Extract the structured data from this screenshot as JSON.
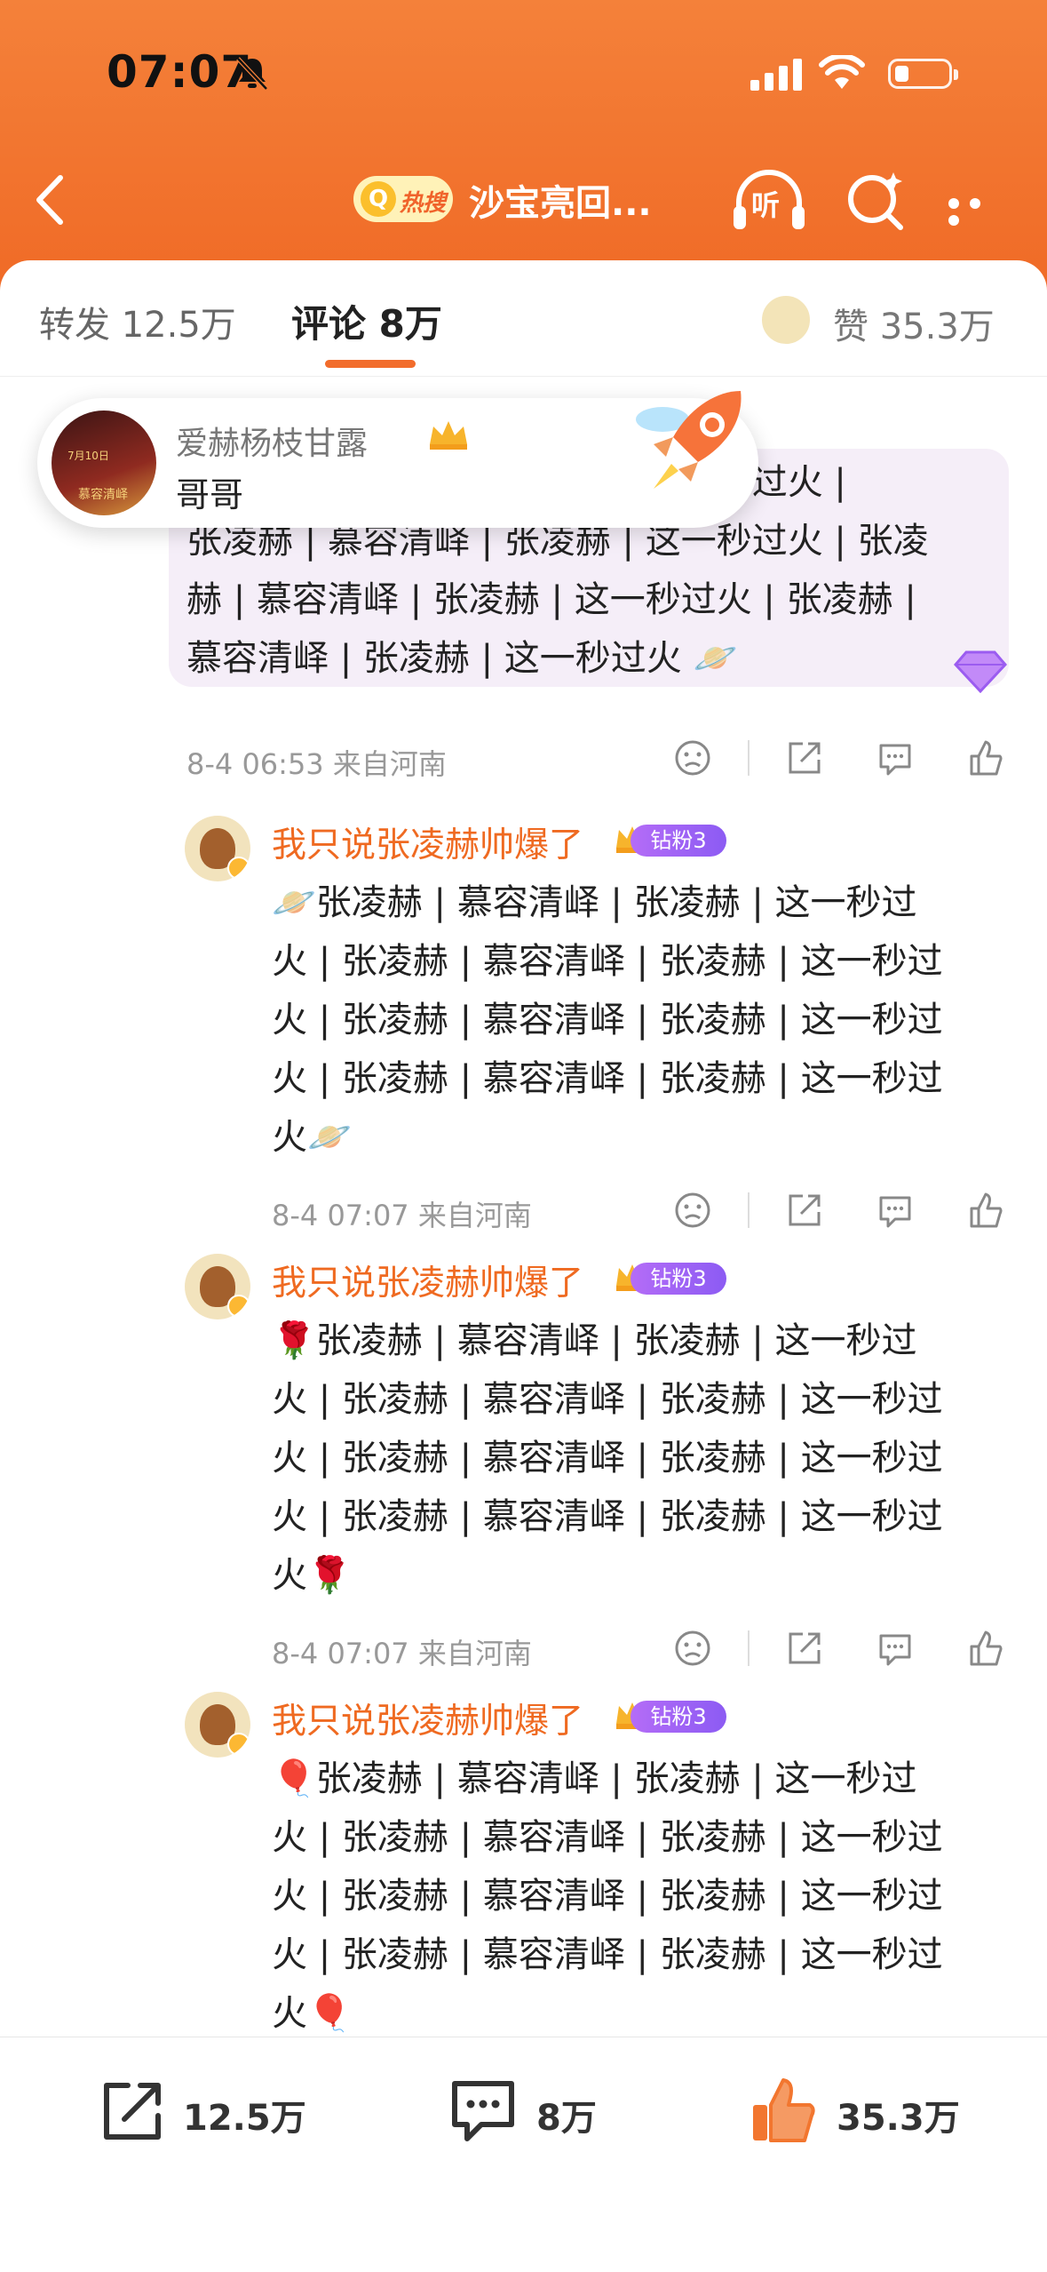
{
  "status": {
    "time": "07:07"
  },
  "nav": {
    "hot_label": "热搜",
    "title": "沙宝亮回...",
    "listen_label": "听"
  },
  "tabs": {
    "repost": "转发 12.5万",
    "comment": "评论 8万",
    "like": "赞 35.3万"
  },
  "popup": {
    "username": "爱赫杨枝甘露",
    "message": "哥哥",
    "avatar_text_1": "7月10日",
    "avatar_text_2": "慕容清峄"
  },
  "comments": [
    {
      "lines": [
        "张凌赫 | 慕容清峄 | 张凌赫 | 这一秒过火 |",
        "张凌赫 | 慕容清峄 | 张凌赫 | 这一秒过火 | 张凌",
        "赫 | 慕容清峄 | 张凌赫 | 这一秒过火 | 张凌赫 |",
        "慕容清峄 | 张凌赫 | 这一秒过火 🪐"
      ],
      "meta": "8-4 06:53  来自河南"
    },
    {
      "username": "我只说张凌赫帅爆了",
      "badge": "钻粉3",
      "lines": [
        "🪐张凌赫 | 慕容清峄 | 张凌赫 | 这一秒过",
        "火 | 张凌赫 | 慕容清峄 | 张凌赫 | 这一秒过",
        "火 | 张凌赫 | 慕容清峄 | 张凌赫 | 这一秒过",
        "火 | 张凌赫 | 慕容清峄 | 张凌赫 | 这一秒过",
        "火🪐"
      ],
      "meta": "8-4 07:07  来自河南"
    },
    {
      "username": "我只说张凌赫帅爆了",
      "badge": "钻粉3",
      "lines": [
        "🌹张凌赫 | 慕容清峄 | 张凌赫 | 这一秒过",
        "火 | 张凌赫 | 慕容清峄 | 张凌赫 | 这一秒过",
        "火 | 张凌赫 | 慕容清峄 | 张凌赫 | 这一秒过",
        "火 | 张凌赫 | 慕容清峄 | 张凌赫 | 这一秒过",
        "火🌹"
      ],
      "meta": "8-4 07:07  来自河南"
    },
    {
      "username": "我只说张凌赫帅爆了",
      "badge": "钻粉3",
      "lines": [
        "🎈张凌赫 | 慕容清峄 | 张凌赫 | 这一秒过",
        "火 | 张凌赫 | 慕容清峄 | 张凌赫 | 这一秒过",
        "火 | 张凌赫 | 慕容清峄 | 张凌赫 | 这一秒过",
        "火 | 张凌赫 | 慕容清峄 | 张凌赫 | 这一秒过",
        "火🎈"
      ]
    }
  ],
  "bottom_bar": {
    "repost": "12.5万",
    "comment": "8万",
    "like": "35.3万"
  },
  "colors": {
    "header": "#f06a26",
    "accent": "#ef6a21",
    "badge": "#8c5bf3"
  }
}
